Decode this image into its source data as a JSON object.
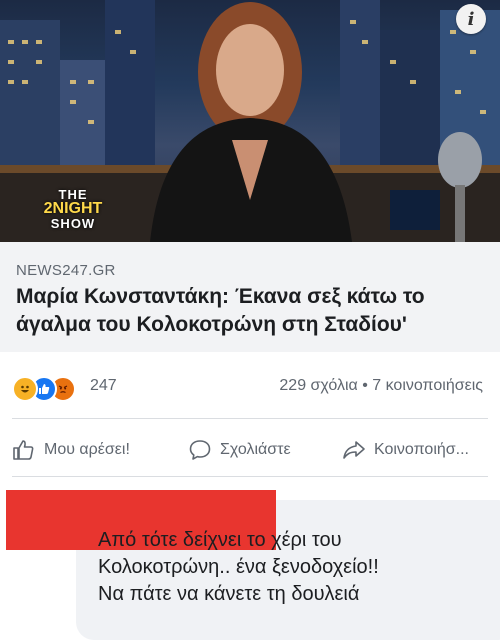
{
  "post": {
    "show_logo": {
      "line1": "THE",
      "line2": "2NIGHT",
      "line3": "SHOW"
    },
    "info_glyph": "i",
    "source": "NEWS247.GR",
    "headline": "Μαρία Κωνσταντάκη: Έκανα σεξ κάτω το άγαλμα του Κολοκοτρώνη στη Σταδίου'",
    "reactions": {
      "icons": [
        "haha-icon",
        "like-icon",
        "angry-icon"
      ],
      "count": "247",
      "stats": "229 σχόλια • 7 κοινοποιήσεις"
    },
    "actions": {
      "like": "Μου αρέσει!",
      "comment": "Σχολιάστε",
      "share": "Κοινοποιήσ..."
    }
  },
  "comment": {
    "line1": "Από τότε δείχνει το χέρι του",
    "line2": "Κολοκοτρώνη.. ένα ξενοδοχείο!!",
    "line3": "Να πάτε να κάνετε τη δουλειά"
  },
  "colors": {
    "reaction_haha": "#f7b125",
    "reaction_like": "#1877f2",
    "reaction_angry": "#e9710f",
    "redaction": "#e8352f"
  }
}
